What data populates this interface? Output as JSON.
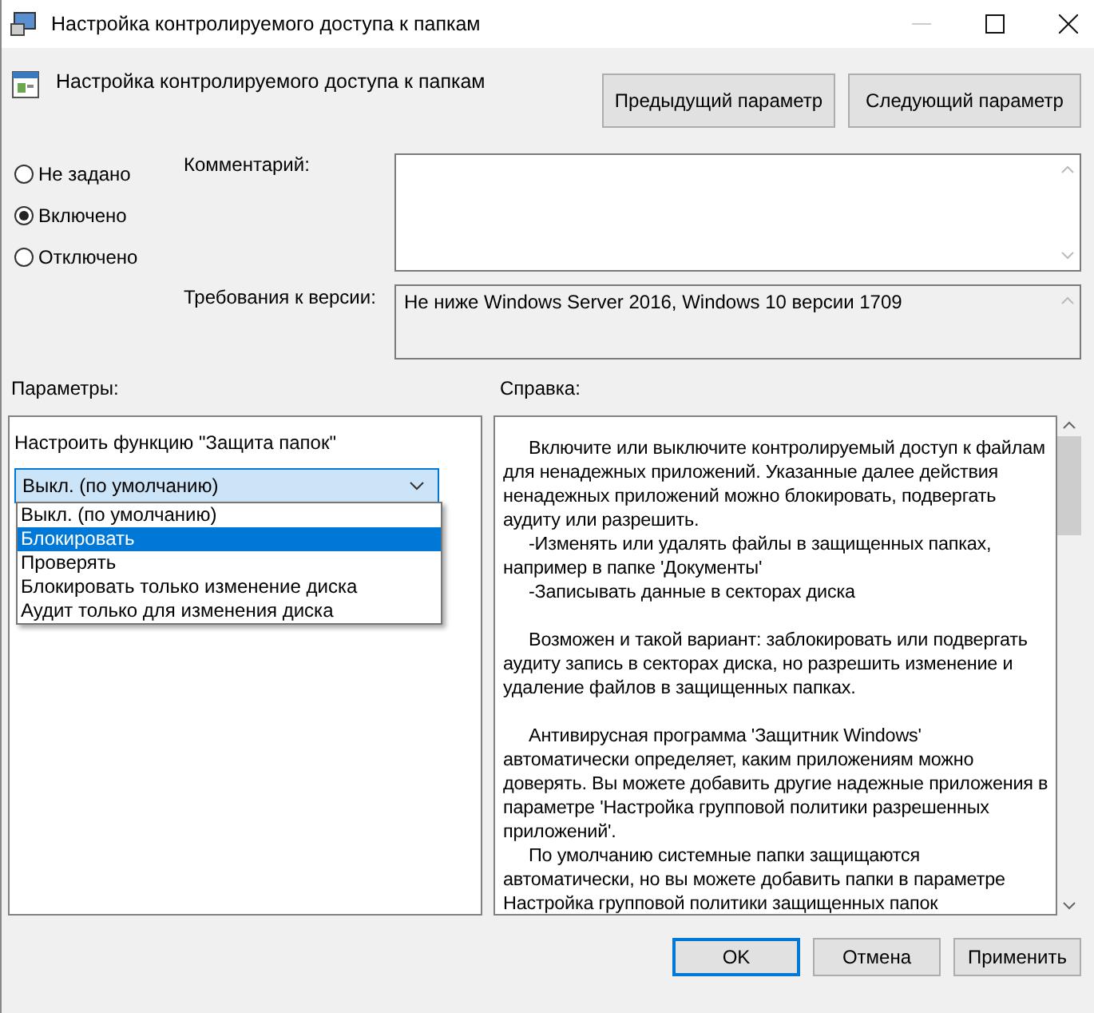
{
  "window": {
    "title": "Настройка контролируемого доступа к папкам"
  },
  "header": {
    "title": "Настройка контролируемого доступа к папкам",
    "buttons": [
      "Предыдущий параметр",
      "Следующий параметр"
    ]
  },
  "state_options": [
    {
      "label": "Не задано",
      "selected": false
    },
    {
      "label": "Включено",
      "selected": true
    },
    {
      "label": "Отключено",
      "selected": false
    }
  ],
  "comment": {
    "label": "Комментарий:"
  },
  "requirements": {
    "label": "Требования к версии:",
    "value": "Не ниже Windows Server 2016, Windows 10 версии 1709"
  },
  "parameters": {
    "label": "Параметры:",
    "setting_label": "Настроить функцию \"Защита папок\"",
    "combo_value": "Выкл. (по умолчанию)",
    "options": [
      {
        "label": "Выкл. (по умолчанию)",
        "selected": false
      },
      {
        "label": "Блокировать",
        "selected": true
      },
      {
        "label": "Проверять",
        "selected": false
      },
      {
        "label": "Блокировать только изменение диска",
        "selected": false
      },
      {
        "label": "Аудит только для изменения диска",
        "selected": false
      }
    ]
  },
  "help": {
    "label": "Справка:",
    "sections": [
      {
        "paragraphs": [
          "Включите или выключите контролируемый доступ к файлам для ненадежных приложений. Указанные далее действия ненадежных приложений можно блокировать, подвергать аудиту или разрешить.",
          "-Изменять или удалять файлы в защищенных папках, например в папке 'Документы'",
          "-Записывать данные в секторах диска"
        ]
      },
      {
        "paragraphs": [
          "Возможен и такой вариант: заблокировать или подвергать аудиту запись в секторах диска, но разрешить изменение и удаление файлов в защищенных папках."
        ]
      },
      {
        "paragraphs": [
          "Антивирусная программа 'Защитник Windows' автоматически определяет, каким приложениям можно доверять. Вы можете добавить другие надежные приложения в параметре 'Настройка групповой политики разрешенных приложений'.",
          "По умолчанию системные папки защищаются автоматически, но вы можете добавить папки в параметре Настройка групповой политики защищенных папок"
        ]
      }
    ]
  },
  "footer": {
    "buttons": [
      {
        "label": "OK",
        "default": true
      },
      {
        "label": "Отмена",
        "default": false
      },
      {
        "label": "Применить",
        "default": false
      }
    ]
  }
}
